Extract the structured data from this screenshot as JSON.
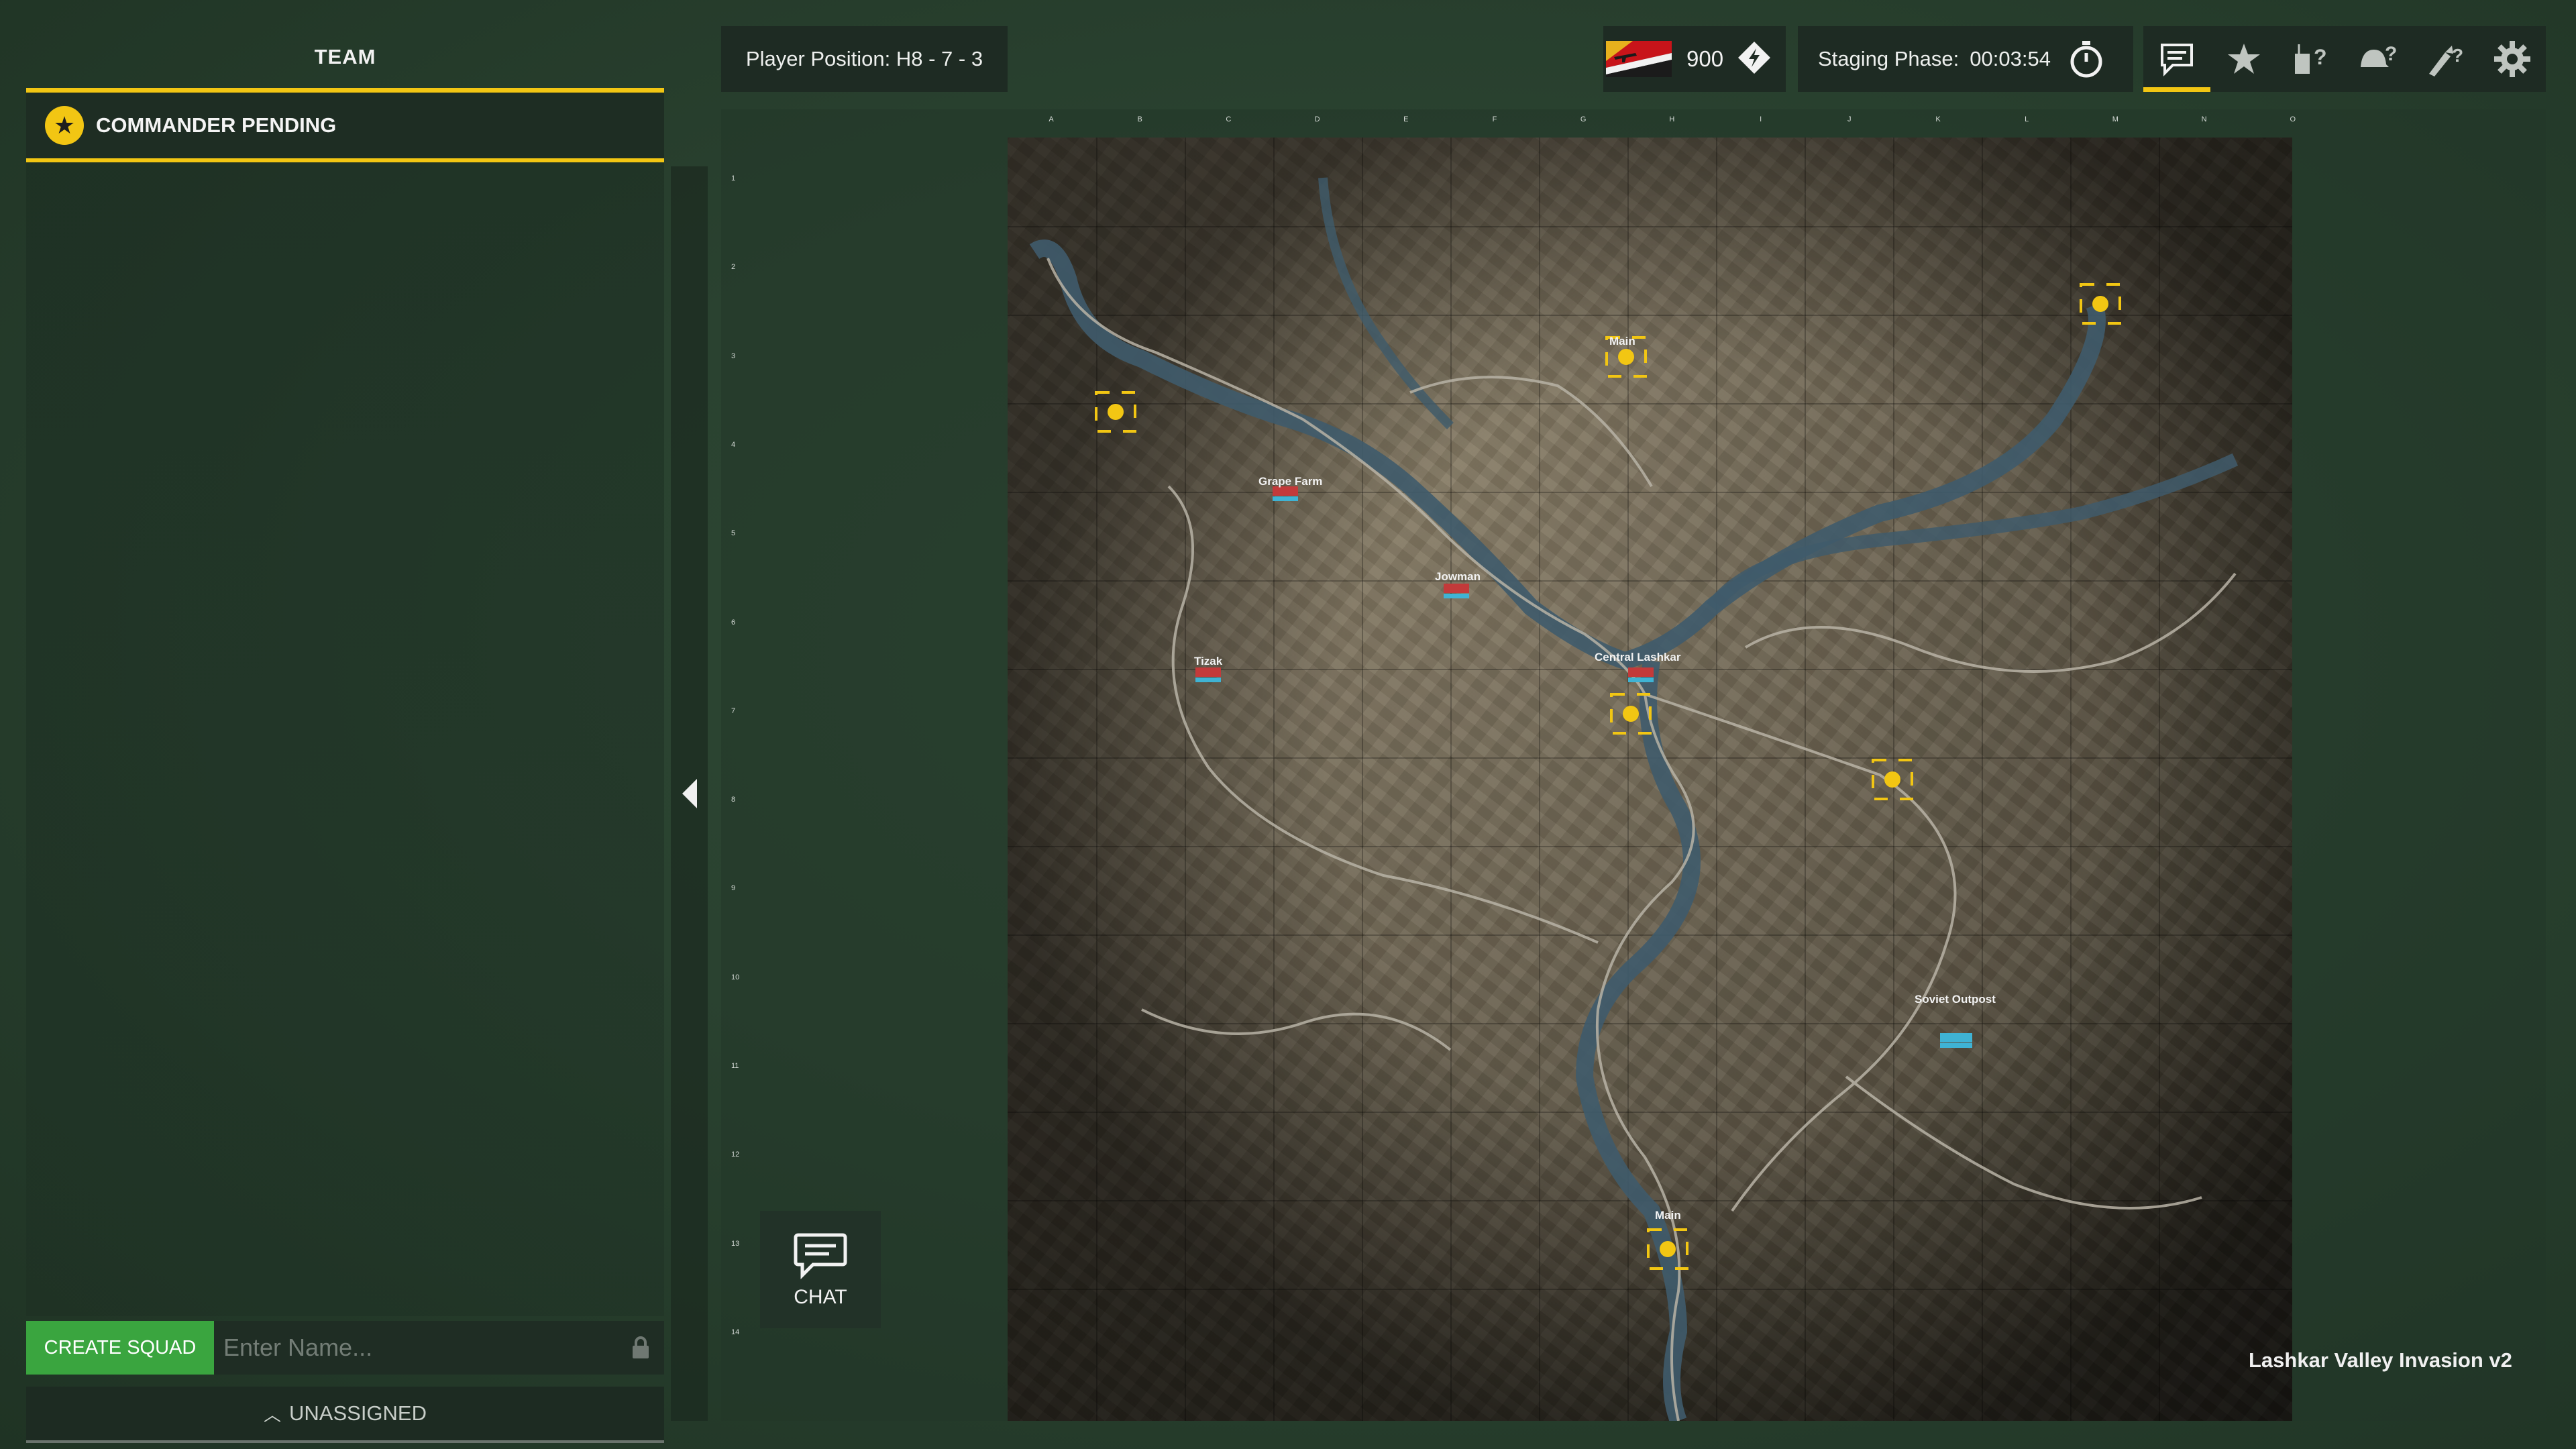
{
  "team_panel": {
    "title": "TEAM",
    "commander_label": "COMMANDER PENDING",
    "create_squad_label": "CREATE SQUAD",
    "squad_name_placeholder": "Enter Name...",
    "unassigned_label": "UNASSIGNED"
  },
  "top_bar": {
    "player_position": "Player Position: H8 - 7 - 3",
    "tickets": "900",
    "phase_label": "Staging Phase:",
    "phase_timer": "00:03:54"
  },
  "toolbar": {
    "icons": [
      "chat-bubble-icon",
      "star-icon",
      "radio-request-icon",
      "helmet-request-icon",
      "rocket-request-icon",
      "gear-icon"
    ],
    "active_index": 0
  },
  "map": {
    "name": "Lashkar Valley Invasion v2",
    "grid_columns": [
      "A",
      "B",
      "C",
      "D",
      "E",
      "F",
      "G",
      "H",
      "I",
      "J",
      "K",
      "L",
      "M",
      "N",
      "O"
    ],
    "grid_rows": [
      "1",
      "2",
      "3",
      "4",
      "5",
      "6",
      "7",
      "8",
      "9",
      "10",
      "11",
      "12",
      "13",
      "14"
    ],
    "place_names": [
      "Main",
      "Grape Farm",
      "Jowman",
      "Tizak",
      "Central Lashkar",
      "Soviet Outpost",
      "Main"
    ]
  },
  "chat_button": {
    "label": "CHAT"
  },
  "colors": {
    "accent": "#f2c613",
    "create_button": "#3aa53f",
    "panel_bg": "#1e2b23"
  }
}
